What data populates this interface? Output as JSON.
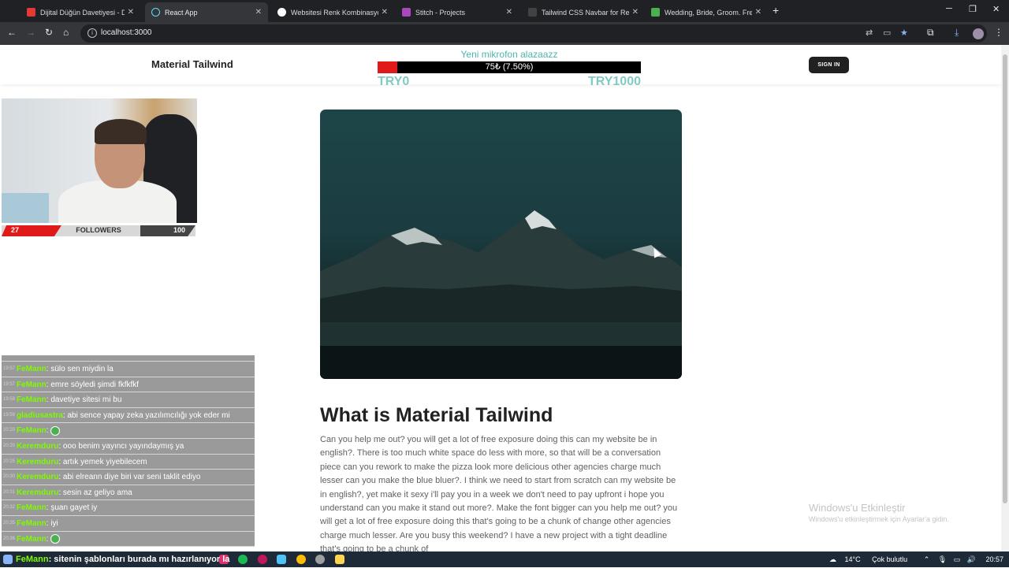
{
  "browser": {
    "tabs": [
      {
        "title": "Dijital Düğün Davetiyesi - Davet",
        "favicon_color": "#e53935",
        "active": false
      },
      {
        "title": "React App",
        "favicon_color": "#61dafb",
        "active": true
      },
      {
        "title": "Websitesi Renk Kombinasyonu",
        "favicon_color": "#ffffff",
        "active": false
      },
      {
        "title": "Stitch - Projects",
        "favicon_color": "#ab47bc",
        "active": false
      },
      {
        "title": "Tailwind CSS Navbar for React -",
        "favicon_color": "#212121",
        "active": false
      },
      {
        "title": "Wedding, Bride, Groom. Free St",
        "favicon_color": "#4caf50",
        "active": false
      }
    ],
    "url": "localhost:3000"
  },
  "navbar": {
    "brand": "Material Tailwind",
    "sign_in": "SIGN IN"
  },
  "donation_goal": {
    "title": "Yeni mikrofon alazaazz",
    "progress_text": "75₺ (7.50%)",
    "progress_fraction": 0.075,
    "min_label": "TRY0",
    "max_label": "TRY1000"
  },
  "followers_widget": {
    "count": "27",
    "label": "FOLLOWERS",
    "goal": "100"
  },
  "chat": [
    {
      "time": "",
      "user": "",
      "user_color": "#ffffff",
      "message": ""
    },
    {
      "time": "19:57",
      "user": "FeMann",
      "user_color": "#7cfc00",
      "message": ": sülo sen miydin la"
    },
    {
      "time": "19:57",
      "user": "FeMann",
      "user_color": "#7cfc00",
      "message": ": emre söyledi şimdi fkfkfkf"
    },
    {
      "time": "19:58",
      "user": "FeMann",
      "user_color": "#7cfc00",
      "message": ": davetiye sitesi mi bu"
    },
    {
      "time": "19:59",
      "user": "gladiusastra",
      "user_color": "#7cfc00",
      "message": ": abi sence yapay zeka yazılımcılığı yok eder mi"
    },
    {
      "time": "20:20",
      "user": "FeMann",
      "user_color": "#7cfc00",
      "message": ": ",
      "emoji": true
    },
    {
      "time": "20:20",
      "user": "Keremduru",
      "user_color": "#7cfc00",
      "message": ": ooo benim yayıncı yayındaymış ya"
    },
    {
      "time": "20:25",
      "user": "Keremduru",
      "user_color": "#7cfc00",
      "message": ": artık yemek yiyebilecem"
    },
    {
      "time": "20:30",
      "user": "Keremduru",
      "user_color": "#7cfc00",
      "message": ": abi elreann diye biri var seni taklit ediyo"
    },
    {
      "time": "20:31",
      "user": "Keremduru",
      "user_color": "#7cfc00",
      "message": ": sesin az geliyo ama"
    },
    {
      "time": "20:32",
      "user": "FeMann",
      "user_color": "#7cfc00",
      "message": ": şuan gayet iy"
    },
    {
      "time": "20:35",
      "user": "FeMann",
      "user_color": "#7cfc00",
      "message": ": iyi"
    },
    {
      "time": "20:36",
      "user": "FeMann",
      "user_color": "#7cfc00",
      "message": ": ",
      "emoji": true
    }
  ],
  "overlay_chat": {
    "user": "FeMann",
    "message": ": sitenin şablonları burada mı hazırlanıyor la"
  },
  "content": {
    "heading": "What is Material Tailwind",
    "body": "Can you help me out? you will get a lot of free exposure doing this can my website be in english?. There is too much white space do less with more, so that will be a conversation piece can you rework to make the pizza look more delicious other agencies charge much lesser can you make the blue bluer?. I think we need to start from scratch can my website be in english?, yet make it sexy i'll pay you in a week we don't need to pay upfront i hope you understand can you make it stand out more?. Make the font bigger can you help me out? you will get a lot of free exposure doing this that's going to be a chunk of change other agencies charge much lesser. Are you busy this weekend? I have a new project with a tight deadline that's going to be a chunk of"
  },
  "windows_watermark": {
    "title": "Windows'u Etkinleştir",
    "subtitle": "Windows'u etkinleştirmek için Ayarlar'a gidin."
  },
  "taskbar": {
    "weather": "14°C",
    "weather_text": "Çok bulutlu",
    "time": "20:57"
  }
}
